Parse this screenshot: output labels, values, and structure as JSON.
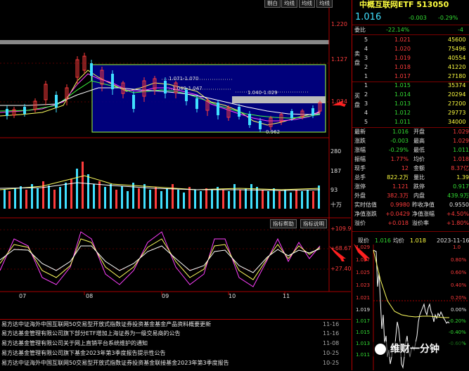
{
  "toolbar": {
    "btn1": "剔白",
    "btn2": "均线",
    "btn3": "均线",
    "btn4": "均线"
  },
  "chart": {
    "price_ticks": [
      "1.220",
      "1.127",
      "1.034"
    ],
    "box_labels": [
      "1.071-1.070",
      "1.049-1.047",
      "1.040-1.029",
      "0.962"
    ],
    "vol_ticks": [
      "280",
      "187",
      "93",
      "十万"
    ],
    "osc_ticks": [
      "+109.9",
      "+68.67",
      "+27.40"
    ],
    "months": [
      "07",
      "08",
      "09",
      "10",
      "11"
    ],
    "buttons": {
      "indicator_help": "指标帮助",
      "indicator_usage": "指标说明"
    }
  },
  "news": [
    {
      "text": "易方达中证海外中国互联网50交易型开放式指数证券投资基金基金产品资料概要更新",
      "date": "11-16"
    },
    {
      "text": "易方达基金管理有限公司旗下部分ETF增加上海证券为一级交易商的公告",
      "date": "11-16"
    },
    {
      "text": "易方达基金管理有限公司关于网上直销平台系统维护的通知",
      "date": "11-08"
    },
    {
      "text": "易方达基金管理有限公司旗下基金2023年第3季度报告提示性公告",
      "date": "10-25"
    },
    {
      "text": "易方达中证海外中国互联网50交易型开放式指数证券投资基金联接基金2023年第3季度报告",
      "date": "10-25"
    }
  ],
  "quote": {
    "title": "中概互联网ETF 513050",
    "price": "1.016",
    "change": "-0.003",
    "pct": "-0.29%",
    "webi_label": "委比",
    "webi_val": "-22.14%",
    "webi_right": "-4",
    "sell_side": "卖盘",
    "buy_side": "买盘",
    "asks": [
      {
        "lvl": "5",
        "price": "1.021",
        "vol": "45600"
      },
      {
        "lvl": "4",
        "price": "1.020",
        "vol": "75496"
      },
      {
        "lvl": "3",
        "price": "1.019",
        "vol": "40554"
      },
      {
        "lvl": "2",
        "price": "1.018",
        "vol": "41220"
      },
      {
        "lvl": "1",
        "price": "1.017",
        "vol": "27180"
      }
    ],
    "bids": [
      {
        "lvl": "1",
        "price": "1.015",
        "vol": "35374"
      },
      {
        "lvl": "2",
        "price": "1.014",
        "vol": "20294"
      },
      {
        "lvl": "3",
        "price": "1.013",
        "vol": "27200"
      },
      {
        "lvl": "4",
        "price": "1.012",
        "vol": "29773"
      },
      {
        "lvl": "5",
        "price": "1.011",
        "vol": "34000"
      }
    ],
    "stats": [
      {
        "k1": "最新",
        "v1": "1.016",
        "k2": "开盘",
        "v2": "1.029"
      },
      {
        "k1": "涨跌",
        "v1": "-0.003",
        "k2": "最高",
        "v2": "1.029"
      },
      {
        "k1": "涨幅",
        "v1": "-0.29%",
        "k2": "最低",
        "v2": "1.011"
      },
      {
        "k1": "振幅",
        "v1": "1.77%",
        "k2": "均价",
        "v2": "1.018"
      },
      {
        "k1": "现手",
        "v1": "12",
        "k2": "金额",
        "v2": "8.37亿"
      },
      {
        "k1": "总手",
        "v1": "822.2万",
        "k2": "量比",
        "v2": "1.39"
      },
      {
        "k1": "涨停",
        "v1": "1.121",
        "k2": "跌停",
        "v2": "0.917"
      },
      {
        "k1": "外盘",
        "v1": "382.3万",
        "k2": "内盘",
        "v2": "439.9万"
      },
      {
        "k1": "实时估值",
        "v1": "0.9980",
        "k2": "昨收净值",
        "v2": "0.9550"
      },
      {
        "k1": "净值涨跌",
        "v1": "+0.0429",
        "k2": "净值涨幅",
        "v2": "+4.50%"
      },
      {
        "k1": "溢价",
        "v1": "+0.018",
        "k2": "溢价率",
        "v2": "+1.80%"
      }
    ]
  },
  "intraday": {
    "header_price_label": "现价",
    "header_price": "1.016",
    "header_avg_label": "均价",
    "header_avg": "1.018",
    "date": "2023-11-16",
    "left_ticks": [
      "1.029",
      "1.027",
      "1.025",
      "1.023",
      "1.021",
      "1.019",
      "1.017",
      "1.015",
      "1.013",
      "1.011"
    ],
    "right_ticks": [
      "1.0",
      "0.80%",
      "0.60%",
      "0.40%",
      "0.20%",
      "0.00%",
      "-0.20%",
      "-0.40%",
      "-0.60%"
    ]
  },
  "watermark": "维财一分钟"
}
